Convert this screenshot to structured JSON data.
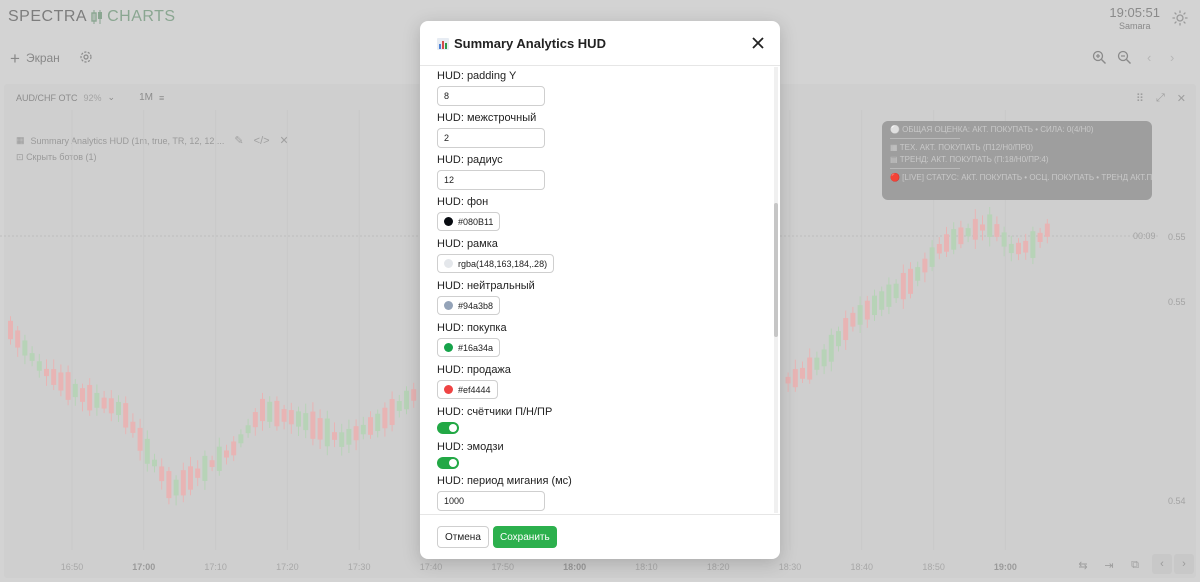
{
  "app": {
    "logo_left": "SPECTRA",
    "logo_right": "CHARTS",
    "clock_time": "19:05:51",
    "clock_zone": "Samara"
  },
  "toolbar": {
    "screen_label": "Экран"
  },
  "chart_panel": {
    "symbol": "AUD/CHF OTC",
    "payout": "92%",
    "timeframe": "1M",
    "indicator_label": "Summary Analytics HUD (1m, true, TR, 12, 12,...",
    "bots_label": "Скрыть ботов (1)",
    "countdown": "00:09"
  },
  "hud": {
    "lines": [
      "⚪ ОБЩАЯ ОЦЕНКА: АКТ. ПОКУПАТЬ • СИЛА: 0(4/Н0)",
      "▦ ТЕХ. АКТ. ПОКУПАТЬ (П12/Н0/ПР0)",
      "▤ ТРЕНД: АКТ. ПОКУПАТЬ (П:18/Н0/ПР:4)",
      "🔴 [LIVE] СТАТУС: АКТ. ПОКУПАТЬ • ОСЦ. ПОКУПАТЬ • ТРЕНД АКТ.П"
    ]
  },
  "modal": {
    "title": "Summary Analytics HUD",
    "title_icon": "bar-chart-icon",
    "fields": [
      {
        "label": "HUD: padding Y",
        "type": "text",
        "value": "8"
      },
      {
        "label": "HUD: межстрочный",
        "type": "text",
        "value": "2"
      },
      {
        "label": "HUD: радиус",
        "type": "text",
        "value": "12"
      },
      {
        "label": "HUD: фон",
        "type": "color",
        "value": "#080B11",
        "color": "#080B11"
      },
      {
        "label": "HUD: рамка",
        "type": "color",
        "value": "rgba(148,163,184,.28)",
        "color": "#e4e7eb"
      },
      {
        "label": "HUD: нейтральный",
        "type": "color",
        "value": "#94a3b8",
        "color": "#94a3b8"
      },
      {
        "label": "HUD: покупка",
        "type": "color",
        "value": "#16a34a",
        "color": "#16a34a"
      },
      {
        "label": "HUD: продажа",
        "type": "color",
        "value": "#ef4444",
        "color": "#ef4444"
      },
      {
        "label": "HUD: счётчики П/Н/ПР",
        "type": "toggle",
        "value": "on"
      },
      {
        "label": "HUD: эмодзи",
        "type": "toggle",
        "value": "on"
      },
      {
        "label": "HUD: период мигания (мс)",
        "type": "text",
        "value": "1000"
      }
    ],
    "cancel_label": "Отмена",
    "save_label": "Сохранить"
  },
  "colors": {
    "accent_green": "#2cb04d",
    "bull_candle": "#b7d3b7",
    "bear_candle": "#e8b4b4"
  },
  "chart_data": {
    "type": "candlestick",
    "x_ticks": [
      "16:50",
      "17:00",
      "17:10",
      "17:20",
      "17:30",
      "17:40",
      "17:50",
      "18:00",
      "18:10",
      "18:20",
      "18:30",
      "18:40",
      "18:50",
      "19:00"
    ],
    "y_ticks": [
      "0.55",
      "0.55",
      "0.54"
    ]
  }
}
